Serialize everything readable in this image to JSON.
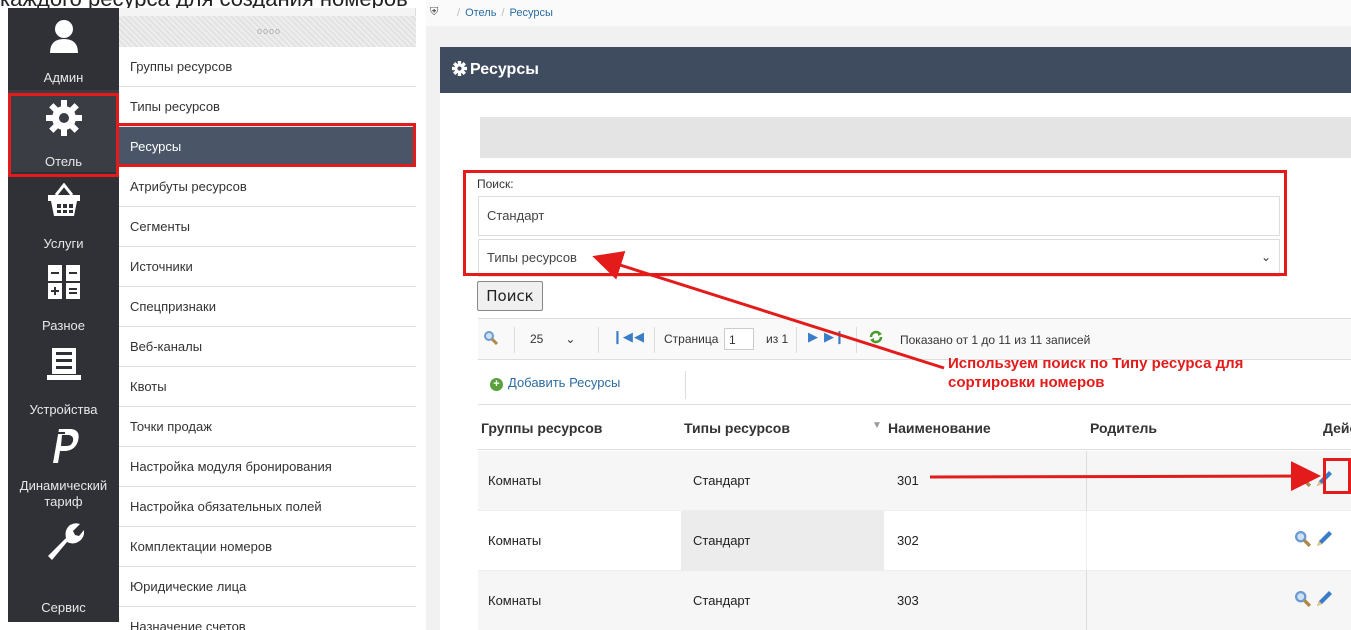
{
  "caption": "каждого ресурса для создания номеров",
  "sidebar": {
    "items": [
      {
        "label": "Админ",
        "icon": "user-icon"
      },
      {
        "label": "Отель",
        "icon": "gear-icon"
      },
      {
        "label": "Услуги",
        "icon": "basket-icon"
      },
      {
        "label": "Разное",
        "icon": "calculator-icon"
      },
      {
        "label": "Устройства",
        "icon": "list-icon"
      },
      {
        "label": "Динамический тариф",
        "icon": "paypal-icon"
      },
      {
        "label": "Сервис",
        "icon": "wrench-icon"
      }
    ]
  },
  "menu": {
    "items": [
      "Группы ресурсов",
      "Типы ресурсов",
      "Ресурсы",
      "Атрибуты ресурсов",
      "Сегменты",
      "Источники",
      "Спецпризнаки",
      "Веб-каналы",
      "Квоты",
      "Точки продаж",
      "Настройка модуля бронирования",
      "Настройка обязательных полей",
      "Комплектации номеров",
      "Юридические лица",
      "Назначение счетов"
    ],
    "active_index": 2
  },
  "breadcrumb": {
    "level1": "Отель",
    "level2": "Ресурсы"
  },
  "panel": {
    "title": "Ресурсы"
  },
  "search": {
    "label": "Поиск:",
    "query": "Стандарт",
    "filter": "Типы ресурсов",
    "button": "Поиск"
  },
  "pager": {
    "page_size": "25",
    "page_label": "Страница",
    "page": "1",
    "of": "из 1",
    "summary": "Показано от 1 до 11 из 11 записей"
  },
  "toolbar": {
    "add_label": "Добавить Ресурсы"
  },
  "table": {
    "columns": [
      "Группы ресурсов",
      "Типы ресурсов",
      "Наименование",
      "Родитель",
      "Дейс"
    ],
    "rows": [
      {
        "group": "Комнаты",
        "type": "Стандарт",
        "name": "301",
        "parent": ""
      },
      {
        "group": "Комнаты",
        "type": "Стандарт",
        "name": "302",
        "parent": ""
      },
      {
        "group": "Комнаты",
        "type": "Стандарт",
        "name": "303",
        "parent": ""
      }
    ]
  },
  "annotation": {
    "line1": "Используем поиск по Типу ресурса для",
    "line2": "сортировки номеров",
    "color": "#e31b1b"
  }
}
